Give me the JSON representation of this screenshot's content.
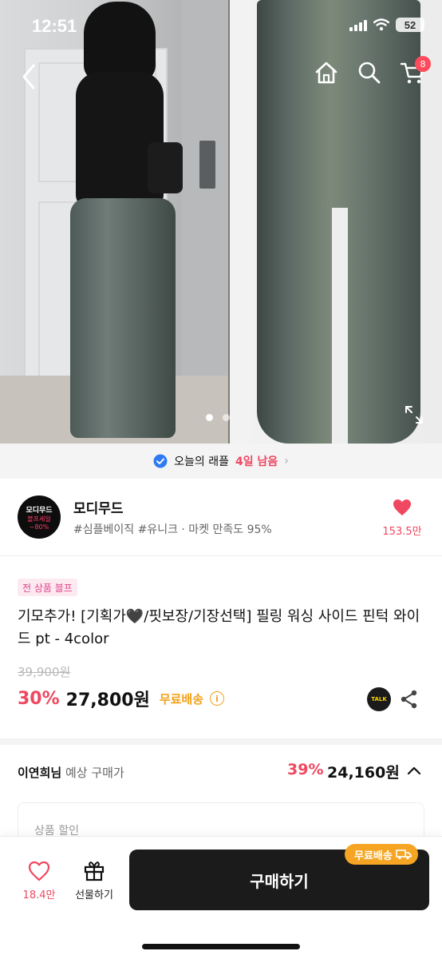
{
  "status": {
    "time": "12:51",
    "battery": "52"
  },
  "header": {
    "cart_count": "8"
  },
  "raffle": {
    "prefix": "오늘의 래플",
    "days_left": "4일 남음",
    "chevron": "›"
  },
  "shop": {
    "logo": {
      "line1": "모디무드",
      "line2": "블프세일",
      "line3": "~80%"
    },
    "name": "모디무드",
    "tags": "#심플베이직 #유니크 · 마켓 만족도 95%",
    "likes": "153.5만"
  },
  "product": {
    "promo_tag": "전 상품 블프",
    "title": "기모추가! [기획가🖤/핏보장/기장선택] 필링 워싱 사이드 핀턱 와이드 pt - 4color",
    "original_price": "39,900원",
    "discount": "30%",
    "price": "27,800원",
    "free_shipping": "무료배송",
    "info_symbol": "i",
    "talk_label": "TALK"
  },
  "expected": {
    "user": "이연희님",
    "label": "예상 구매가",
    "rate": "39%",
    "amount": "24,160원"
  },
  "discount_section": {
    "label": "상품 할인"
  },
  "bottom_bar": {
    "likes": "18.4만",
    "gift_label": "선물하기",
    "buy_label": "구매하기",
    "ship_badge": "무료배송"
  },
  "colors": {
    "accent_red": "#ef4860",
    "ship_orange": "#f5a523",
    "buy_dark": "#1b1b1b"
  }
}
